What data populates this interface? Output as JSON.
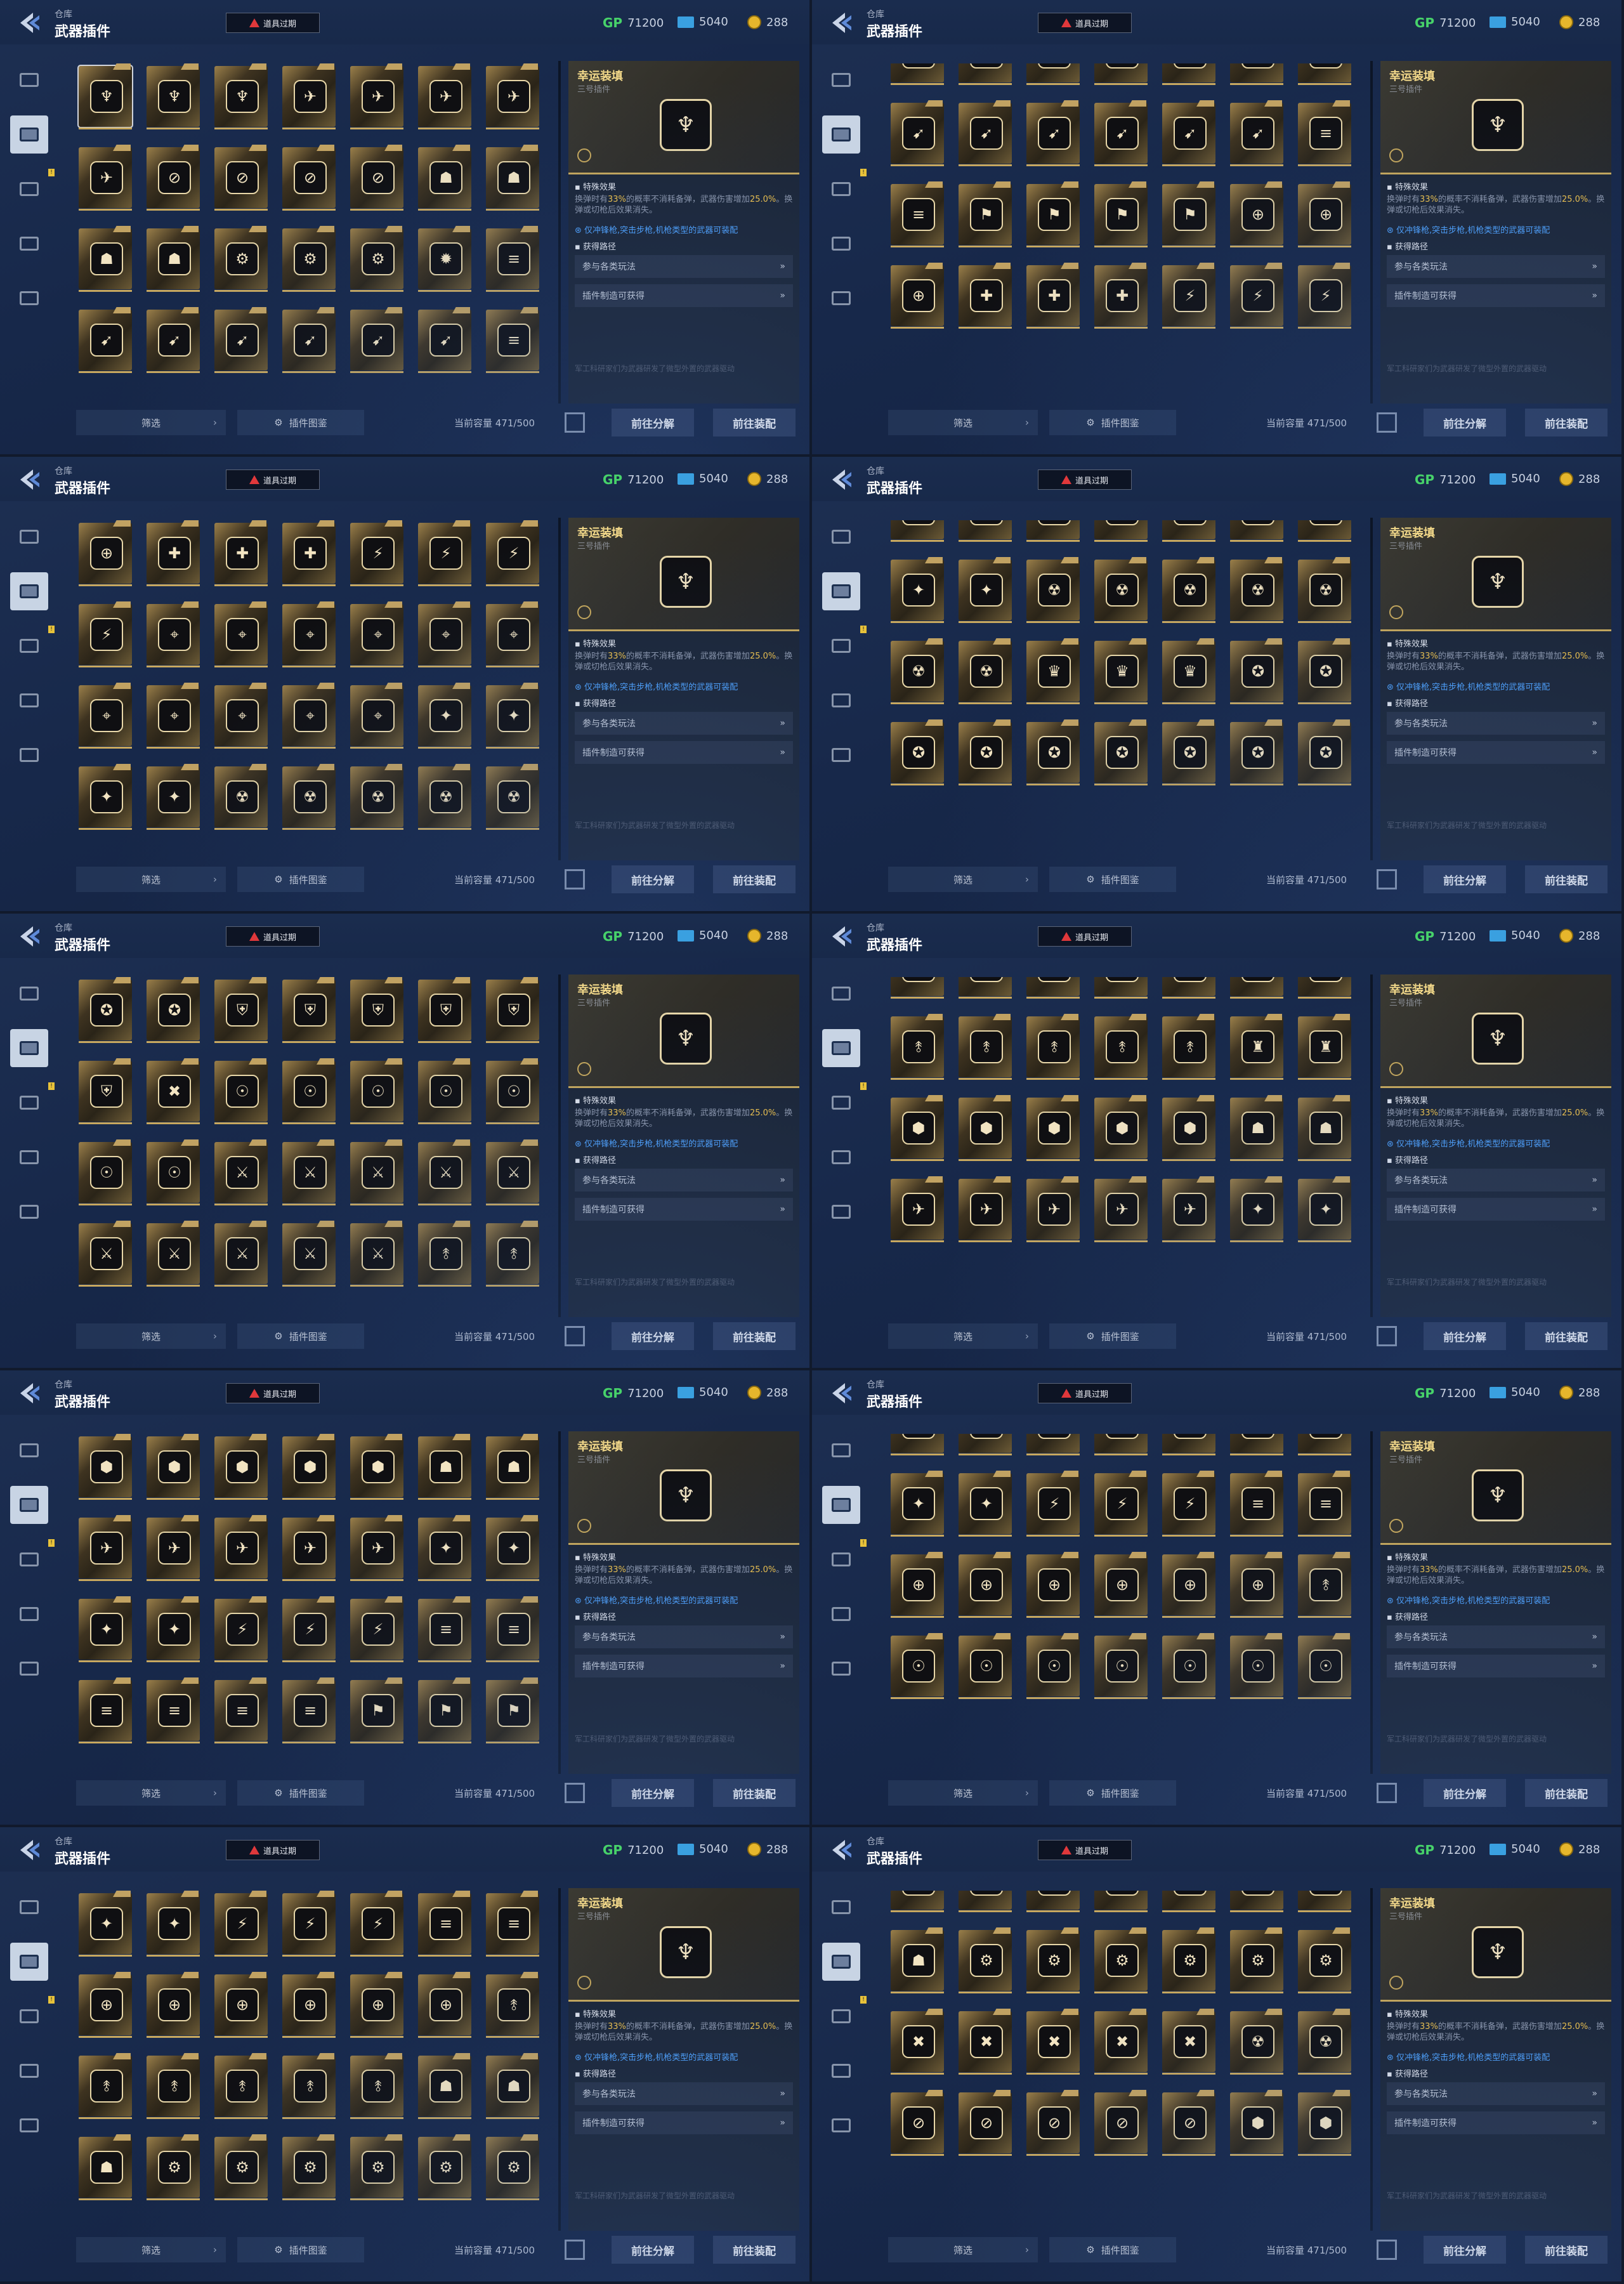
{
  "header": {
    "breadcrumb": "仓库",
    "title": "武器插件",
    "expire_badge": "道具过期",
    "currency": {
      "gp_label": "GP",
      "gp_value": "71200",
      "ticket_value": "5040",
      "coin_value": "288"
    }
  },
  "sidebar": {
    "badge": "!"
  },
  "detail": {
    "name": "幸运装填",
    "subtitle": "三号插件",
    "effect_heading": "特殊效果",
    "effect_pre": "换弹时有",
    "effect_pct": "33%",
    "effect_mid": "的概率不消耗备弹，武器伤害增加",
    "effect_dmg": "25.0%",
    "effect_post": "。换弹或切枪后效果消失。",
    "restriction": "仅冲锋枪,突击步枪,机枪类型的武器可装配",
    "source_heading": "获得路径",
    "source_1": "参与各类玩法",
    "source_2": "插件制造可获得",
    "flavor": "军工科研家们为武器研发了微型外置的武器驱动"
  },
  "footer": {
    "filter": "筛选",
    "codex": "插件图鉴",
    "capacity": "当前容量 471/500",
    "dismantle": "前往分解",
    "equip": "前往装配"
  },
  "icons": {
    "glyphs": [
      "♆",
      "✈",
      "⊘",
      "☗",
      "⚙",
      "✹",
      "≡",
      "⊕",
      "☢",
      "✦",
      "⬢",
      "➹",
      "⚑",
      "✚",
      "⚡",
      "⌖",
      "♛",
      "✪",
      "⛨",
      "✖",
      "☉",
      "⚔",
      "⥉",
      "♜"
    ]
  },
  "panels": [
    {
      "row_offset": 0,
      "icons": [
        [
          0,
          0,
          0,
          1,
          1,
          1,
          1
        ],
        [
          1,
          2,
          2,
          2,
          2,
          3,
          3
        ],
        [
          3,
          3,
          4,
          4,
          4,
          5,
          6
        ],
        [
          11,
          11,
          11,
          11,
          11,
          11,
          6
        ]
      ]
    },
    {
      "row_offset": -1,
      "icons": [
        [
          1,
          1,
          1,
          1,
          1,
          1,
          1
        ],
        [
          11,
          11,
          11,
          11,
          11,
          11,
          6
        ],
        [
          6,
          12,
          12,
          12,
          12,
          7,
          7
        ],
        [
          7,
          13,
          13,
          13,
          14,
          14,
          14
        ]
      ]
    },
    {
      "row_offset": 0,
      "icons": [
        [
          7,
          13,
          13,
          13,
          14,
          14,
          14
        ],
        [
          14,
          15,
          15,
          15,
          15,
          15,
          15
        ],
        [
          15,
          15,
          15,
          15,
          15,
          9,
          9
        ],
        [
          9,
          9,
          8,
          8,
          8,
          8,
          8
        ]
      ]
    },
    {
      "row_offset": -1,
      "icons": [
        [
          9,
          9,
          8,
          8,
          8,
          8,
          8
        ],
        [
          9,
          9,
          8,
          8,
          8,
          8,
          8
        ],
        [
          8,
          8,
          16,
          16,
          16,
          17,
          17
        ],
        [
          17,
          17,
          17,
          17,
          17,
          17,
          17
        ]
      ]
    },
    {
      "row_offset": 0,
      "icons": [
        [
          17,
          17,
          18,
          18,
          18,
          18,
          18
        ],
        [
          18,
          19,
          20,
          20,
          20,
          20,
          20
        ],
        [
          20,
          20,
          21,
          21,
          21,
          21,
          21
        ],
        [
          21,
          21,
          21,
          21,
          21,
          22,
          22
        ]
      ]
    },
    {
      "row_offset": -1,
      "icons": [
        [
          21,
          21,
          21,
          21,
          21,
          22,
          22
        ],
        [
          22,
          22,
          22,
          22,
          22,
          23,
          23
        ],
        [
          10,
          10,
          10,
          10,
          10,
          3,
          3
        ],
        [
          1,
          1,
          1,
          1,
          1,
          9,
          9
        ]
      ]
    },
    {
      "row_offset": 0,
      "icons": [
        [
          10,
          10,
          10,
          10,
          10,
          3,
          3
        ],
        [
          1,
          1,
          1,
          1,
          1,
          9,
          9
        ],
        [
          9,
          9,
          14,
          14,
          14,
          6,
          6
        ],
        [
          6,
          6,
          6,
          6,
          12,
          12,
          12
        ]
      ]
    },
    {
      "row_offset": -1,
      "icons": [
        [
          4,
          4,
          9,
          9,
          6,
          6,
          6
        ],
        [
          9,
          9,
          14,
          14,
          14,
          6,
          6
        ],
        [
          7,
          7,
          7,
          7,
          7,
          7,
          22
        ],
        [
          20,
          20,
          20,
          20,
          20,
          20,
          20
        ]
      ]
    },
    {
      "row_offset": 0,
      "icons": [
        [
          9,
          9,
          14,
          14,
          14,
          6,
          6
        ],
        [
          7,
          7,
          7,
          7,
          7,
          7,
          22
        ],
        [
          22,
          22,
          22,
          22,
          22,
          3,
          3
        ],
        [
          3,
          4,
          4,
          4,
          4,
          4,
          4
        ]
      ]
    },
    {
      "row_offset": -1,
      "icons": [
        [
          3,
          3,
          6,
          6,
          6,
          7,
          7
        ],
        [
          3,
          4,
          4,
          4,
          4,
          4,
          4
        ],
        [
          19,
          19,
          19,
          19,
          19,
          8,
          8
        ],
        [
          2,
          2,
          2,
          2,
          2,
          10,
          10
        ]
      ]
    }
  ]
}
